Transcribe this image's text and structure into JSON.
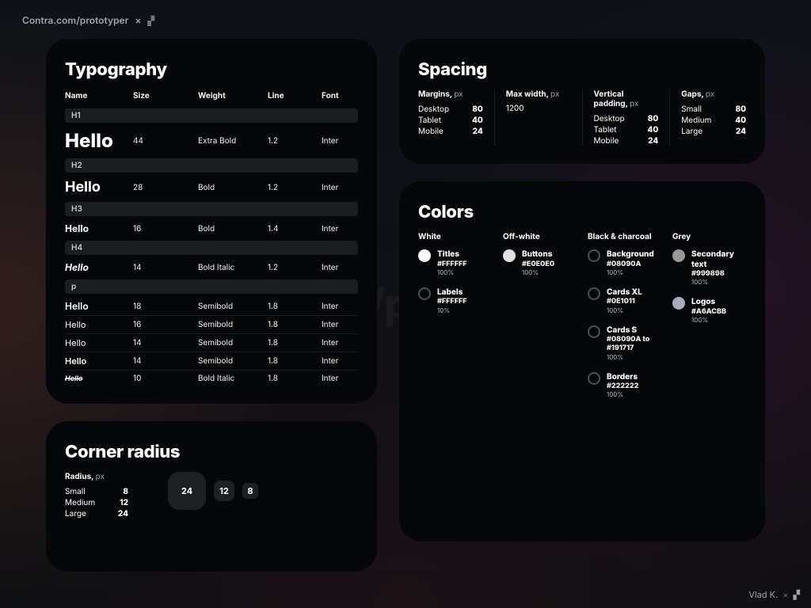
{
  "site": {
    "breadcrumb": "Contra.com/prototyper",
    "watermark": "Contra.com/prototyper ×",
    "footer_name": "Vlad K."
  },
  "typography": {
    "title": "Typography",
    "columns": [
      "Name",
      "Size",
      "Weight",
      "Line",
      "Font"
    ],
    "rows": [
      {
        "tag": "H1",
        "style": "h1",
        "name": "Hello",
        "size": "44",
        "weight": "Extra Bold",
        "line": "1.2",
        "font": "Inter"
      },
      {
        "tag": "H2",
        "style": "h2",
        "name": "Hello",
        "size": "28",
        "weight": "Bold",
        "line": "1.2",
        "font": "Inter"
      },
      {
        "tag": "H3",
        "style": "h3",
        "name": "Hello",
        "size": "16",
        "weight": "Bold",
        "line": "1.4",
        "font": "Inter"
      },
      {
        "tag": "H4",
        "style": "h4",
        "name": "Hello",
        "size": "14",
        "weight": "Bold Italic",
        "line": "1.2",
        "font": "Inter"
      },
      {
        "tag": "p",
        "style": "p",
        "name": "Hello",
        "size": "18",
        "weight": "Semibold",
        "line": "1.8",
        "font": "Inter"
      },
      {
        "tag": null,
        "style": "sub",
        "name": "Hello",
        "size": "16",
        "weight": "Semibold",
        "line": "1.8",
        "font": "Inter"
      },
      {
        "tag": null,
        "style": "sub2",
        "name": "Hello",
        "size": "14",
        "weight": "Semibold",
        "line": "1.8",
        "font": "Inter"
      },
      {
        "tag": null,
        "style": "sub3",
        "name": "Hello",
        "size": "14",
        "weight": "Semibold",
        "line": "1.8",
        "font": "Inter"
      },
      {
        "tag": null,
        "style": "sub4",
        "name": "Hello",
        "size": "10",
        "weight": "Bold Italic",
        "line": "1.8",
        "font": "Inter"
      }
    ]
  },
  "corner": {
    "title": "Corner radius",
    "label": "Radius,",
    "unit": "px",
    "rows": [
      {
        "k": "Small",
        "v": "8"
      },
      {
        "k": "Medium",
        "v": "12"
      },
      {
        "k": "Large",
        "v": "24"
      }
    ],
    "chips": [
      "24",
      "12",
      "8"
    ]
  },
  "spacing": {
    "title": "Spacing",
    "groups": [
      {
        "label": "Margins,",
        "unit": "px",
        "rows": [
          [
            "Desktop",
            "80"
          ],
          [
            "Tablet",
            "40"
          ],
          [
            "Mobile",
            "24"
          ]
        ]
      },
      {
        "label": "Max width,",
        "unit": "px",
        "single": "1200"
      },
      {
        "label": "Vertical padding,",
        "unit": "px",
        "rows": [
          [
            "Desktop",
            "80"
          ],
          [
            "Tablet",
            "40"
          ],
          [
            "Mobile",
            "24"
          ]
        ]
      },
      {
        "label": "Gaps,",
        "unit": "px",
        "rows": [
          [
            "Small",
            "80"
          ],
          [
            "Medium",
            "40"
          ],
          [
            "Large",
            "24"
          ]
        ]
      }
    ]
  },
  "colors": {
    "title": "Colors",
    "columns": [
      {
        "name": "White",
        "swatches": [
          {
            "label": "Titles",
            "hex": "#FFFFFF",
            "opacity": "100%",
            "dot": "#FFFFFF"
          },
          {
            "label": "Labels",
            "hex": "#FFFFFF",
            "opacity": "10%",
            "dot": "#2b2d30",
            "ring": true
          }
        ]
      },
      {
        "name": "Off-white",
        "swatches": [
          {
            "label": "Buttons",
            "hex": "#E0E0E0",
            "opacity": "100%",
            "dot": "#E0E0E0"
          }
        ]
      },
      {
        "name": "Black & charcoal",
        "swatches": [
          {
            "label": "Background",
            "hex": "#08090A",
            "opacity": "100%",
            "ring": true
          },
          {
            "label": "Cards XL",
            "hex": "#0E1011",
            "opacity": "100%",
            "ring": true
          },
          {
            "label": "Cards S",
            "hex": "#08090A to #191717",
            "opacity": "100%",
            "ring": true
          },
          {
            "label": "Borders",
            "hex": "#222222",
            "opacity": "100%",
            "ring": true
          }
        ]
      },
      {
        "name": "Grey",
        "swatches": [
          {
            "label": "Secondary text",
            "hex": "#999898",
            "opacity": "100%",
            "dot": "#999898"
          },
          {
            "label": "Logos",
            "hex": "#A6ACBB",
            "opacity": "100%",
            "dot": "#A6ACBB"
          }
        ]
      }
    ]
  }
}
